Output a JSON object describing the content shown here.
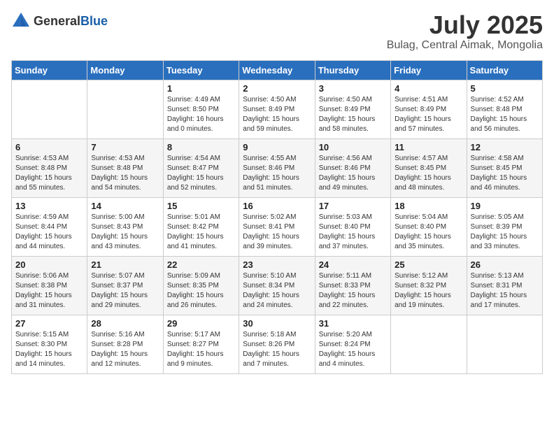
{
  "header": {
    "logo_general": "General",
    "logo_blue": "Blue",
    "month_title": "July 2025",
    "location": "Bulag, Central Aimak, Mongolia"
  },
  "weekdays": [
    "Sunday",
    "Monday",
    "Tuesday",
    "Wednesday",
    "Thursday",
    "Friday",
    "Saturday"
  ],
  "weeks": [
    [
      {
        "day": "",
        "content": ""
      },
      {
        "day": "",
        "content": ""
      },
      {
        "day": "1",
        "content": "Sunrise: 4:49 AM\nSunset: 8:50 PM\nDaylight: 16 hours\nand 0 minutes."
      },
      {
        "day": "2",
        "content": "Sunrise: 4:50 AM\nSunset: 8:49 PM\nDaylight: 15 hours\nand 59 minutes."
      },
      {
        "day": "3",
        "content": "Sunrise: 4:50 AM\nSunset: 8:49 PM\nDaylight: 15 hours\nand 58 minutes."
      },
      {
        "day": "4",
        "content": "Sunrise: 4:51 AM\nSunset: 8:49 PM\nDaylight: 15 hours\nand 57 minutes."
      },
      {
        "day": "5",
        "content": "Sunrise: 4:52 AM\nSunset: 8:48 PM\nDaylight: 15 hours\nand 56 minutes."
      }
    ],
    [
      {
        "day": "6",
        "content": "Sunrise: 4:53 AM\nSunset: 8:48 PM\nDaylight: 15 hours\nand 55 minutes."
      },
      {
        "day": "7",
        "content": "Sunrise: 4:53 AM\nSunset: 8:48 PM\nDaylight: 15 hours\nand 54 minutes."
      },
      {
        "day": "8",
        "content": "Sunrise: 4:54 AM\nSunset: 8:47 PM\nDaylight: 15 hours\nand 52 minutes."
      },
      {
        "day": "9",
        "content": "Sunrise: 4:55 AM\nSunset: 8:46 PM\nDaylight: 15 hours\nand 51 minutes."
      },
      {
        "day": "10",
        "content": "Sunrise: 4:56 AM\nSunset: 8:46 PM\nDaylight: 15 hours\nand 49 minutes."
      },
      {
        "day": "11",
        "content": "Sunrise: 4:57 AM\nSunset: 8:45 PM\nDaylight: 15 hours\nand 48 minutes."
      },
      {
        "day": "12",
        "content": "Sunrise: 4:58 AM\nSunset: 8:45 PM\nDaylight: 15 hours\nand 46 minutes."
      }
    ],
    [
      {
        "day": "13",
        "content": "Sunrise: 4:59 AM\nSunset: 8:44 PM\nDaylight: 15 hours\nand 44 minutes."
      },
      {
        "day": "14",
        "content": "Sunrise: 5:00 AM\nSunset: 8:43 PM\nDaylight: 15 hours\nand 43 minutes."
      },
      {
        "day": "15",
        "content": "Sunrise: 5:01 AM\nSunset: 8:42 PM\nDaylight: 15 hours\nand 41 minutes."
      },
      {
        "day": "16",
        "content": "Sunrise: 5:02 AM\nSunset: 8:41 PM\nDaylight: 15 hours\nand 39 minutes."
      },
      {
        "day": "17",
        "content": "Sunrise: 5:03 AM\nSunset: 8:40 PM\nDaylight: 15 hours\nand 37 minutes."
      },
      {
        "day": "18",
        "content": "Sunrise: 5:04 AM\nSunset: 8:40 PM\nDaylight: 15 hours\nand 35 minutes."
      },
      {
        "day": "19",
        "content": "Sunrise: 5:05 AM\nSunset: 8:39 PM\nDaylight: 15 hours\nand 33 minutes."
      }
    ],
    [
      {
        "day": "20",
        "content": "Sunrise: 5:06 AM\nSunset: 8:38 PM\nDaylight: 15 hours\nand 31 minutes."
      },
      {
        "day": "21",
        "content": "Sunrise: 5:07 AM\nSunset: 8:37 PM\nDaylight: 15 hours\nand 29 minutes."
      },
      {
        "day": "22",
        "content": "Sunrise: 5:09 AM\nSunset: 8:35 PM\nDaylight: 15 hours\nand 26 minutes."
      },
      {
        "day": "23",
        "content": "Sunrise: 5:10 AM\nSunset: 8:34 PM\nDaylight: 15 hours\nand 24 minutes."
      },
      {
        "day": "24",
        "content": "Sunrise: 5:11 AM\nSunset: 8:33 PM\nDaylight: 15 hours\nand 22 minutes."
      },
      {
        "day": "25",
        "content": "Sunrise: 5:12 AM\nSunset: 8:32 PM\nDaylight: 15 hours\nand 19 minutes."
      },
      {
        "day": "26",
        "content": "Sunrise: 5:13 AM\nSunset: 8:31 PM\nDaylight: 15 hours\nand 17 minutes."
      }
    ],
    [
      {
        "day": "27",
        "content": "Sunrise: 5:15 AM\nSunset: 8:30 PM\nDaylight: 15 hours\nand 14 minutes."
      },
      {
        "day": "28",
        "content": "Sunrise: 5:16 AM\nSunset: 8:28 PM\nDaylight: 15 hours\nand 12 minutes."
      },
      {
        "day": "29",
        "content": "Sunrise: 5:17 AM\nSunset: 8:27 PM\nDaylight: 15 hours\nand 9 minutes."
      },
      {
        "day": "30",
        "content": "Sunrise: 5:18 AM\nSunset: 8:26 PM\nDaylight: 15 hours\nand 7 minutes."
      },
      {
        "day": "31",
        "content": "Sunrise: 5:20 AM\nSunset: 8:24 PM\nDaylight: 15 hours\nand 4 minutes."
      },
      {
        "day": "",
        "content": ""
      },
      {
        "day": "",
        "content": ""
      }
    ]
  ]
}
